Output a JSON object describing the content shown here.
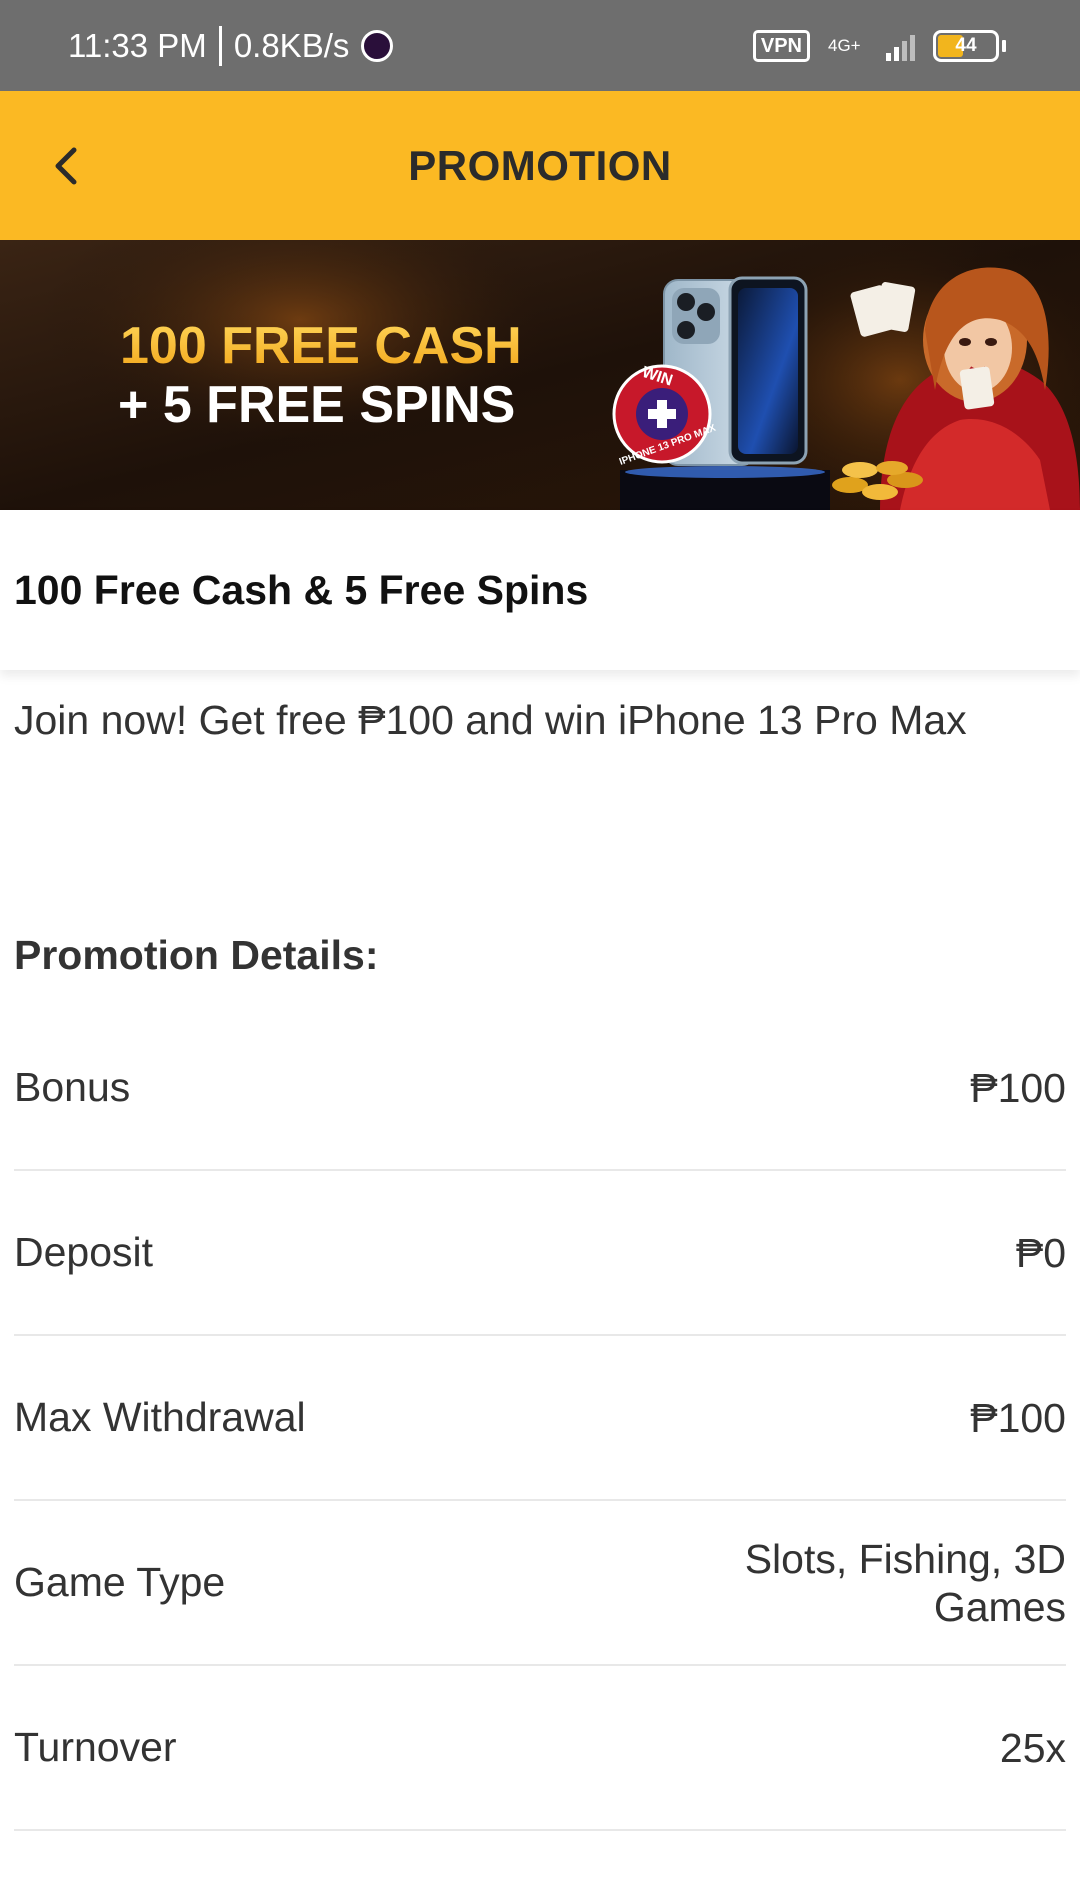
{
  "status_bar": {
    "time": "11:33 PM",
    "speed": "0.8KB/s",
    "vpn": "VPN",
    "network": "4G+",
    "battery": "44",
    "battery_level": 0.44
  },
  "header": {
    "title": "PROMOTION",
    "back_icon": "chevron-left-icon",
    "background": "#fbb923"
  },
  "banner": {
    "line1": "100 FREE CASH",
    "line2": "+ 5 FREE SPINS",
    "badge_top": "WIN",
    "badge_bottom": "IPHONE 13 PRO MAX"
  },
  "promotion": {
    "title": "100 Free Cash & 5 Free Spins",
    "description": "Join now! Get free ₱100 and win iPhone 13 Pro Max",
    "details_heading": "Promotion Details:",
    "details": [
      {
        "label": "Bonus",
        "value": "₱100"
      },
      {
        "label": "Deposit",
        "value": "₱0"
      },
      {
        "label": "Max Withdrawal",
        "value": "₱100"
      },
      {
        "label": "Game Type",
        "value": "Slots, Fishing, 3D Games"
      },
      {
        "label": "Turnover",
        "value": "25x"
      }
    ]
  }
}
